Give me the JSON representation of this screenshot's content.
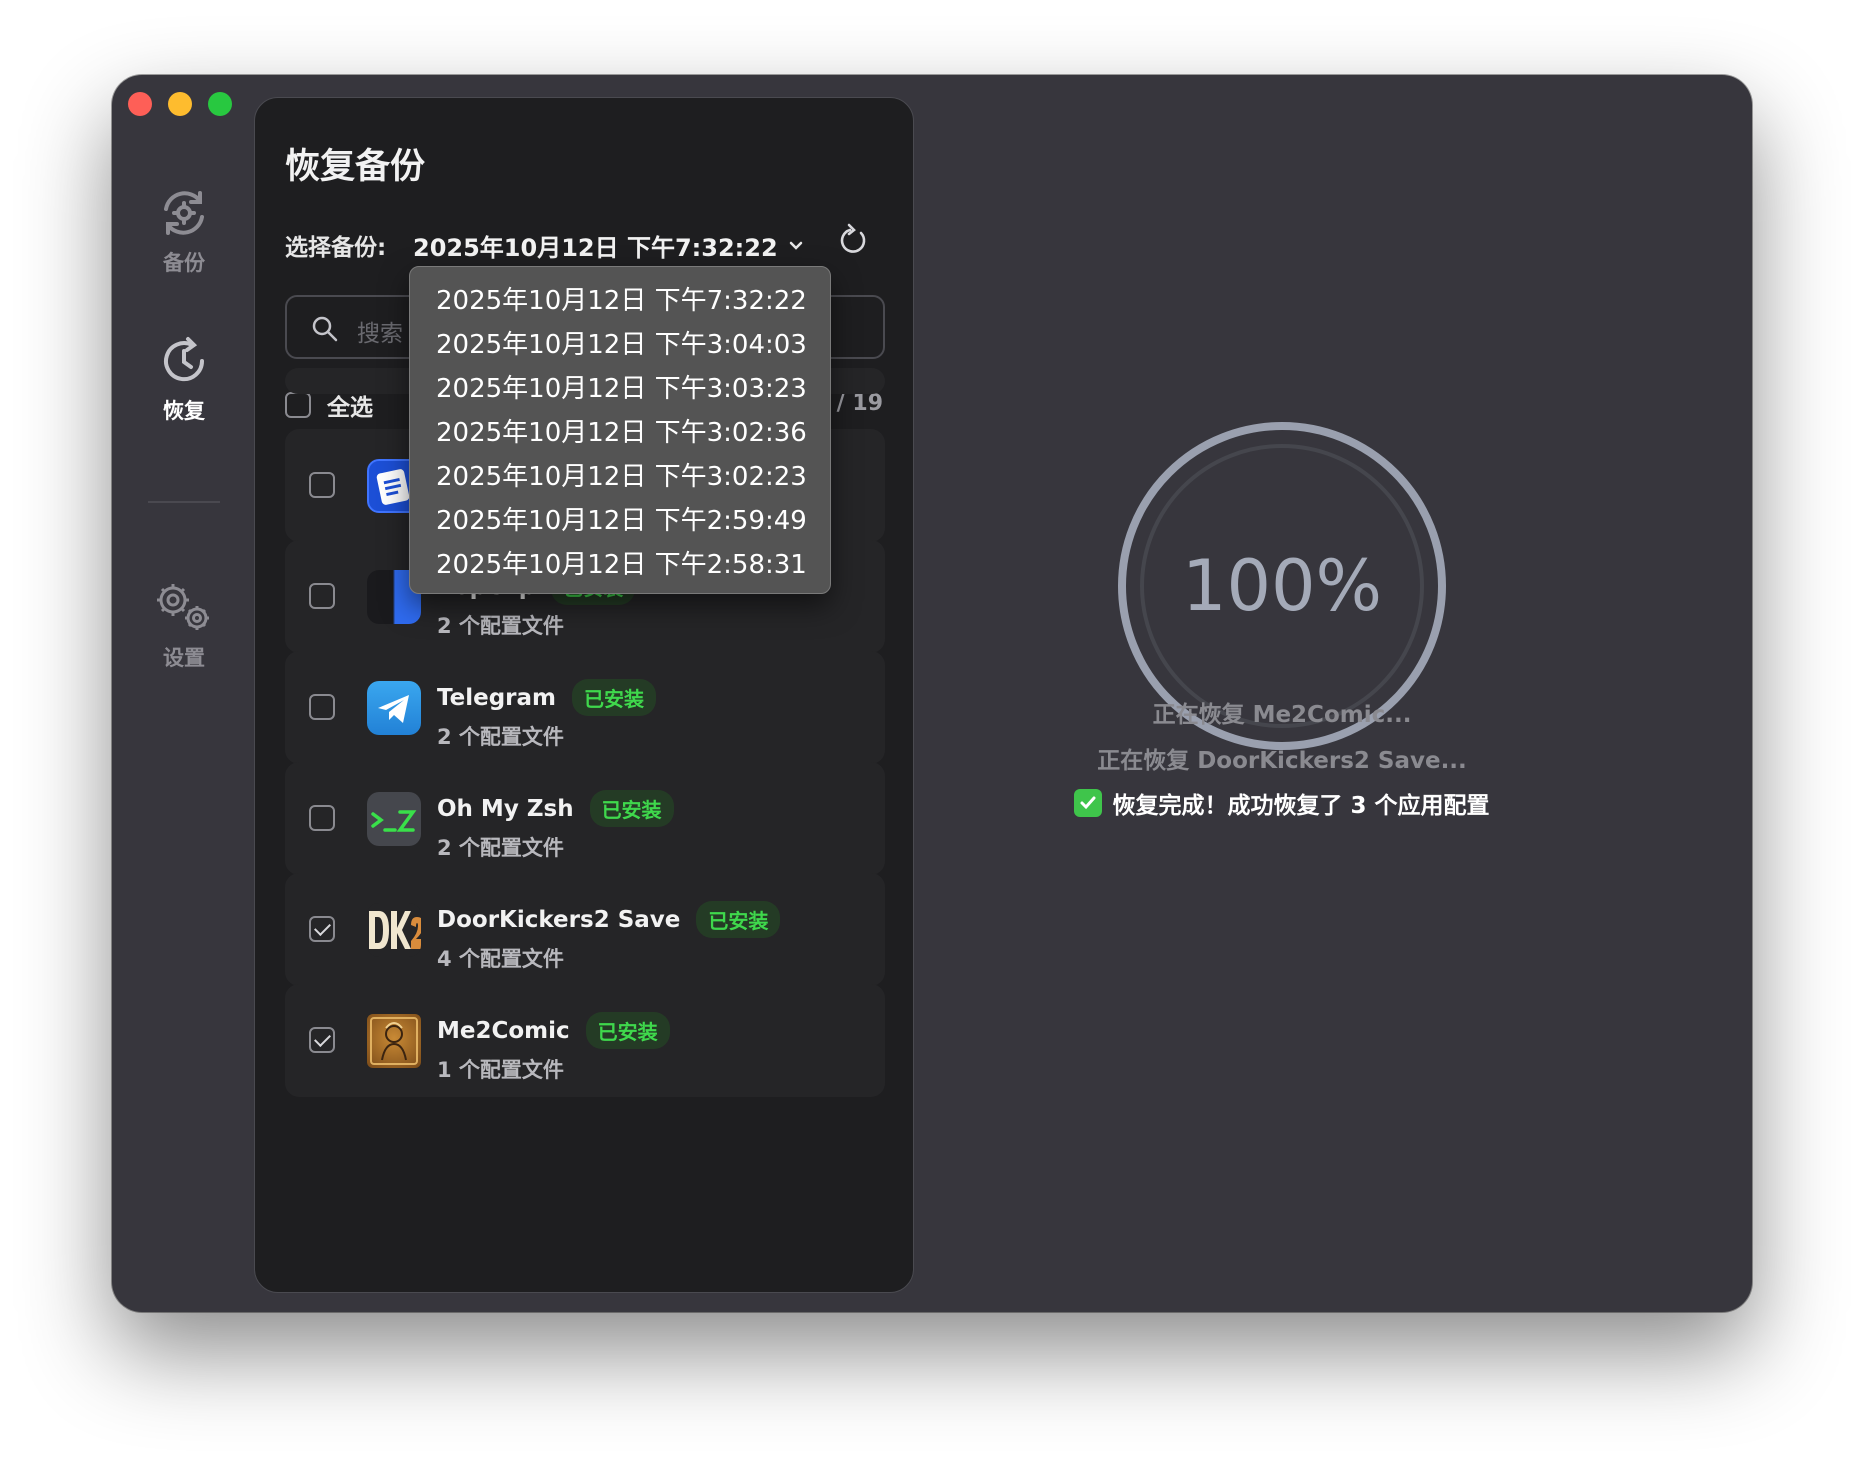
{
  "sidebar": {
    "items": [
      {
        "label": "备份",
        "icon": "backup-icon"
      },
      {
        "label": "恢复",
        "icon": "restore-icon"
      },
      {
        "label": "设置",
        "icon": "settings-icon"
      }
    ]
  },
  "panel": {
    "title": "恢复备份",
    "select_label": "选择备份:",
    "selected_backup": "2025年10月12日 下午7:32:22",
    "search_placeholder": "搜索",
    "select_all_label": "全选",
    "count": "3 / 19"
  },
  "dropdown": {
    "options": [
      "2025年10月12日 下午7:32:22",
      "2025年10月12日 下午3:04:03",
      "2025年10月12日 下午3:03:23",
      "2025年10月12日 下午3:02:36",
      "2025年10月12日 下午3:02:23",
      "2025年10月12日 下午2:59:49",
      "2025年10月12日 下午2:58:31"
    ]
  },
  "apps": [
    {
      "name": "",
      "badge": "",
      "files": "",
      "checked": false,
      "icon": "document-app-icon"
    },
    {
      "name": "PopClip",
      "badge": "已安装",
      "files": "2 个配置文件",
      "checked": false,
      "icon": "popclip-icon"
    },
    {
      "name": "Telegram",
      "badge": "已安装",
      "files": "2 个配置文件",
      "checked": false,
      "icon": "telegram-icon"
    },
    {
      "name": "Oh My Zsh",
      "badge": "已安装",
      "files": "2 个配置文件",
      "checked": false,
      "icon": "terminal-icon"
    },
    {
      "name": "DoorKickers2 Save",
      "badge": "已安装",
      "files": "4 个配置文件",
      "checked": true,
      "icon": "dk2-icon"
    },
    {
      "name": "Me2Comic",
      "badge": "已安装",
      "files": "1 个配置文件",
      "checked": true,
      "icon": "me2comic-icon"
    }
  ],
  "progress": {
    "percent": 100,
    "percent_label": "100%",
    "logs": [
      "正在恢复 Me2Comic...",
      "正在恢复 DoorKickers2 Save...",
      "恢复完成！成功恢复了 3 个应用配置"
    ]
  },
  "colors": {
    "window_bg": "#37363d",
    "panel_bg": "#1e1e20",
    "row_bg": "#252527",
    "badge_text": "#3fd84c",
    "ring": "#9aa0af"
  }
}
